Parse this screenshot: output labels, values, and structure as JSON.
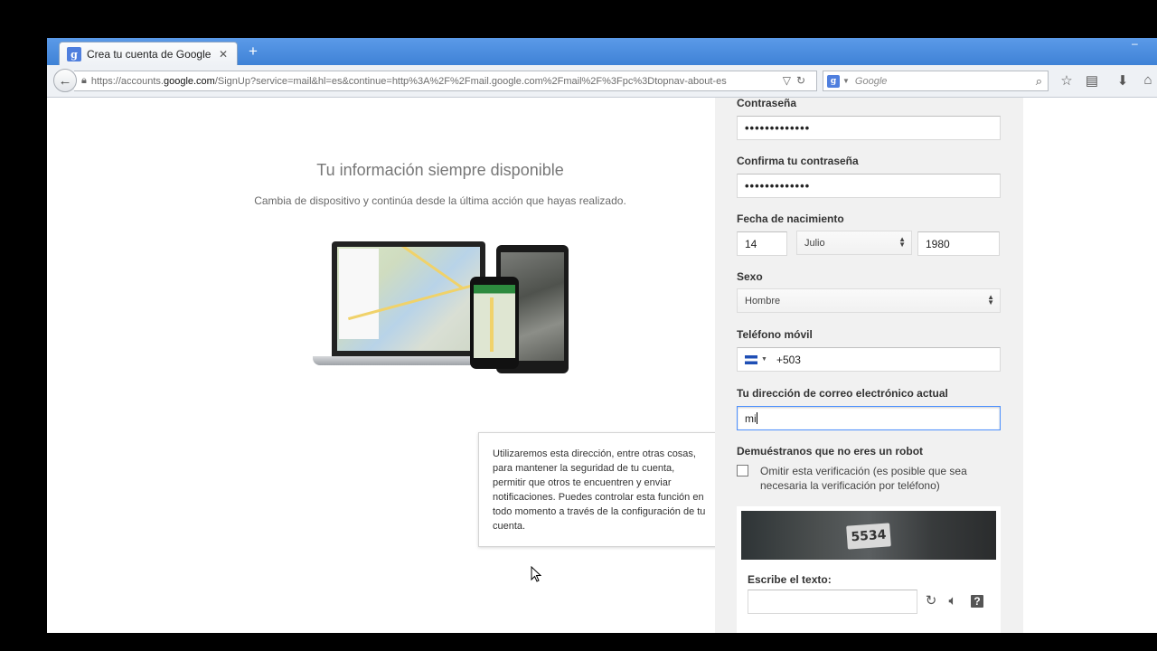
{
  "browser": {
    "tab_title": "Crea tu cuenta de Google",
    "tab_favicon": "g",
    "url_prefix": "https://accounts.",
    "url_domain": "google.com",
    "url_path": "/SignUp?service=mail&hl=es&continue=http%3A%2F%2Fmail.google.com%2Fmail%2F%3Fpc%3Dtopnav-about-es",
    "search_engine_icon": "g",
    "search_placeholder": "Google",
    "accent_color": "#4a8de0"
  },
  "promo": {
    "title": "Tu información siempre disponible",
    "subtitle": "Cambia de dispositivo y continúa desde la última acción que hayas realizado."
  },
  "tooltip": {
    "text": "Utilizaremos esta dirección, entre otras cosas, para mantener la seguridad de tu cuenta, permitir que otros te encuentren y enviar notificaciones. Puedes controlar esta función en todo momento a través de la configuración de tu cuenta."
  },
  "form": {
    "password_label": "Contraseña",
    "password_value": "•••••••••••••",
    "confirm_label": "Confirma tu contraseña",
    "confirm_value": "•••••••••••••",
    "birth_label": "Fecha de nacimiento",
    "birth_day": "14",
    "birth_month": "Julio",
    "birth_year": "1980",
    "gender_label": "Sexo",
    "gender_value": "Hombre",
    "phone_label": "Teléfono móvil",
    "phone_value": "+503",
    "email_label": "Tu dirección de correo electrónico actual",
    "email_value": "mi",
    "robot_label": "Demuéstranos que no eres un robot",
    "skip_label": "Omitir esta verificación (es posible que sea necesaria la verificación por teléfono)",
    "captcha_text_shown": "5534",
    "captcha_input_label": "Escribe el texto:"
  }
}
